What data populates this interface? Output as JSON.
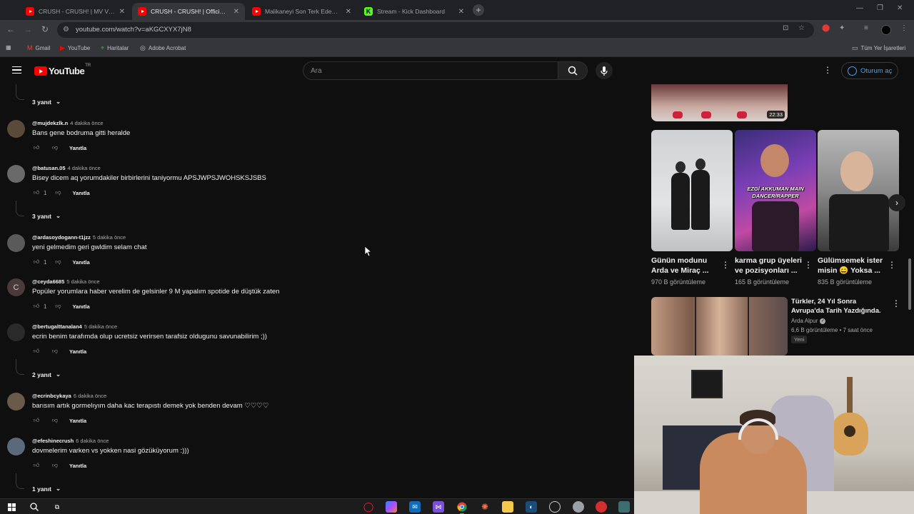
{
  "browser": {
    "tabs": [
      {
        "title": "CRUSH - CRUSH! | MV Vlog - YouTube",
        "icon": "youtube-icon",
        "active": false
      },
      {
        "title": "CRUSH - CRUSH! | Official Music Video",
        "icon": "youtube-icon",
        "active": true
      },
      {
        "title": "Malikaneyi Son Terk Eden Kazanır",
        "icon": "youtube-icon",
        "active": false
      },
      {
        "title": "Stream - Kick Dashboard",
        "icon": "kick-icon",
        "active": false
      }
    ],
    "url": "youtube.com/watch?v=aKGCXYX7jN8",
    "bookmarks": [
      {
        "label": "Gmail",
        "icon": "gmail-icon"
      },
      {
        "label": "YouTube",
        "icon": "youtube-icon"
      },
      {
        "label": "Haritalar",
        "icon": "maps-icon"
      },
      {
        "label": "Adobe Acrobat",
        "icon": "acrobat-icon"
      }
    ],
    "all_bookmarks": "Tüm Yer İşaretleri"
  },
  "youtube": {
    "logo_text": "YouTube",
    "country": "TR",
    "search_placeholder": "Ara",
    "signin_label": "Oturum aç"
  },
  "comments": {
    "items": [
      {
        "type": "replies",
        "label": "3 yanıt"
      },
      {
        "type": "comment",
        "handle": "@mujdekzlk.n",
        "time": "4 dakika önce",
        "text": "Bans gene bodruma gitti heralde",
        "likes": "",
        "reply": "Yanıtla"
      },
      {
        "type": "comment",
        "handle": "@batusan.05",
        "time": "4 dakika önce",
        "text": "Bisey dicem aq yorumdakiler birbirlerini taniyormu APSJWPSJWOHSKSJSBS",
        "likes": "1",
        "reply": "Yanıtla"
      },
      {
        "type": "replies",
        "label": "3 yanıt"
      },
      {
        "type": "comment",
        "handle": "@ardasoydogann-t1jzz",
        "time": "5 dakika önce",
        "text": "yeni gelmedim geri gwldim selam chat",
        "likes": "1",
        "reply": "Yanıtla"
      },
      {
        "type": "comment",
        "handle": "@ceyda6685",
        "time": "5 dakika önce",
        "text": "Popüler yorumlara haber verelim de gelsinler 9 M yapalım spotide de düştük zaten",
        "likes": "1",
        "reply": "Yanıtla"
      },
      {
        "type": "comment",
        "handle": "@bertugalttanalan4",
        "time": "5 dakika önce",
        "text": "ecrin benim tarafımda olup ucretsiz verirsen tarafsiz oldugunu savunabilirim ;))",
        "likes": "",
        "reply": "Yanıtla"
      },
      {
        "type": "replies",
        "label": "2 yanıt"
      },
      {
        "type": "comment",
        "handle": "@ecrinbcykaya",
        "time": "6 dakika önce",
        "text": "barısım artık gormelıyım daha kac terapıstı demek yok benden devam ♡♡♡♡",
        "likes": "",
        "reply": "Yanıtla"
      },
      {
        "type": "comment",
        "handle": "@efeshinecrush",
        "time": "6 dakika önce",
        "text": "dovmelerim varken vs yokken nasi gözüküyorum :)))",
        "likes": "",
        "reply": "Yanıtla"
      },
      {
        "type": "replies",
        "label": "1 yanıt"
      }
    ]
  },
  "sidebar": {
    "top_video_duration": "22:33",
    "shorts": [
      {
        "title": "Günün modunu Arda ve Miraç ...",
        "views": "970 B görüntüleme",
        "overlay": ""
      },
      {
        "title": "karma grup üyeleri ve pozisyonları ...",
        "views": "165 B görüntüleme",
        "overlay": "EZGİ AKKUMAN MAIN DANCER/RAPPER"
      },
      {
        "title": "Gülümsemek ister misin 😄 Yoksa ...",
        "views": "835 B görüntüleme",
        "overlay": ""
      }
    ],
    "video": {
      "title": "Türkler, 24 Yıl Sonra Avrupa'da Tarih Yazdığında.",
      "channel": "Arda Alpur",
      "stats": "6,6 B görüntüleme • 7 saat önce",
      "badge": "Yeni"
    }
  },
  "taskbar": {
    "apps": [
      "windows-start-icon",
      "search-icon",
      "task-view-icon",
      "opera-icon",
      "copilot-icon",
      "mail-icon",
      "visual-studio-icon",
      "chrome-icon",
      "app-icon",
      "file-explorer-icon",
      "steam-icon",
      "app-icon",
      "app-icon",
      "app-icon",
      "app-icon"
    ]
  }
}
